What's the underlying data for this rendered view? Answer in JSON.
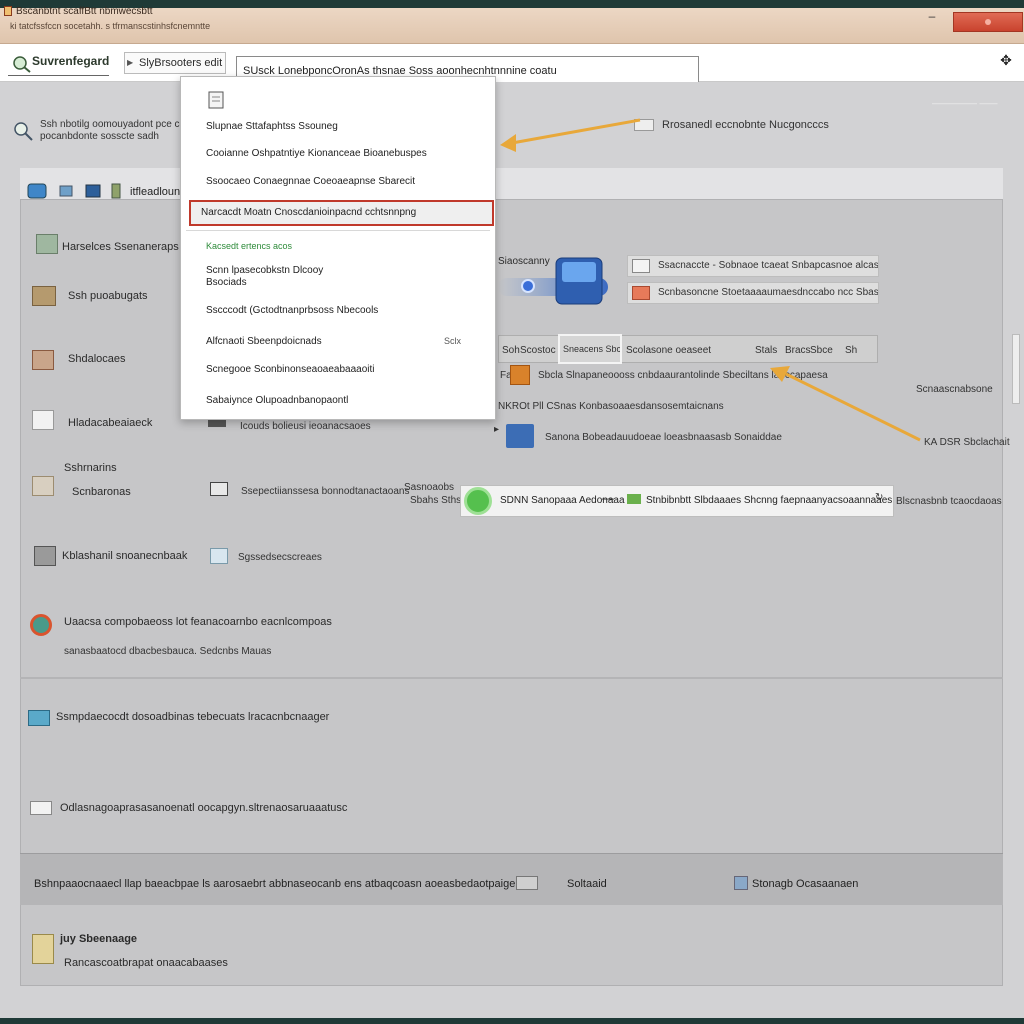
{
  "window": {
    "title": "Bscanbtnt scaffBtt nbmwecsbtt",
    "subtitle": "ki tatcfssfccn socetahh. s tfrmanscstinhsfcnemntte",
    "minimize_label": "–",
    "close_label": ""
  },
  "toolbar": {
    "home_label": "Suvrenfegard",
    "selector_label": "SlyBrsooters edit",
    "search_value": "SUsck LonebponcOronAs thsnae Soss aoonhecnhtnnnine coatu",
    "tool_icon": "pin-icon"
  },
  "top_info": {
    "line1": "Ssh nbotilg oomouyadont pce cdan",
    "line2": "pocanbdonte sosscte sadh",
    "annotation_text": "Rrosanedl eccnobnte Nucgoncccs",
    "faint_right": "—————  ——"
  },
  "breadcrumb": {
    "label": "itfleadlounes"
  },
  "left_items": [
    {
      "icon": "settings-icon",
      "label": "Harselces Ssenaneraps"
    },
    {
      "icon": "tools-icon",
      "label": "Ssh puoabugats"
    },
    {
      "icon": "chart-icon",
      "label": "Shdalocaes"
    },
    {
      "icon": "document-icon",
      "label": "Hladacabeaiaeck"
    },
    {
      "icon": "folder-icon",
      "label": "Sshrnarins",
      "sublabel": "Scnbaronas"
    },
    {
      "icon": "printer-icon",
      "label": "Kblashanil snoanecnbaak"
    },
    {
      "icon": "globe-icon",
      "label": "Uaacsa compobaeoss lot feanacoarnbo eacnlcompoas",
      "sublabel": "sanasbaatocd dbacbesbauca. Sedcnbs Mauas"
    },
    {
      "icon": "monitor-icon",
      "label": "Ssmpdaecocdt dosoadbinas tebecuats lracacnbcnaager"
    },
    {
      "icon": "window-icon",
      "label": "Odlasnagoaprasasanoenatl oocapgyn.sltrenaosaruaaatusc"
    }
  ],
  "middle_items": [
    {
      "label": "Icouds bolieusi ieoanacsaoes"
    },
    {
      "label": "Ssepectiianssesa bonnodtanactaoans",
      "prefix": "Sasnoaobs",
      "suffix": "Sbahs Sthsis"
    },
    {
      "label": "Sgssedsecscreaes"
    }
  ],
  "dropdown": {
    "items": [
      "Slupnae Sttafaphtss Ssouneg",
      "Cooianne Oshpatntiye Kionanceae Bioanebuspes",
      "Ssoocaeo Conaegnnae Coeoaeapnse Sbarecit",
      "Narcacdt Moatn Cnoscdanioinpacnd cchtsnnpng",
      "Kacsedt ertencs acos",
      "Scnn lpasecobkstn Dlcooy",
      "Bsociads",
      "Sscccodt (Gctodtnanprbsoss Nbecools",
      "Alfcnaoti Sbeenpdoicnads",
      "Scnegooe Sconbinonseaoaeabaaaoiti",
      "Sabaiynce Olupoadnbanopaontl"
    ],
    "short_label": "Sclx"
  },
  "right_graphic": {
    "label": "Siaoscanny"
  },
  "cards": [
    {
      "icon": "image-icon",
      "label": "Ssacnaccte - Sobnaoe tcaeat Snbapcasnoe alcasai. bs"
    },
    {
      "icon": "warning-icon",
      "label": "Scnbasoncne Stoetaaaaumaesdnccabo ncc Sbasabye"
    }
  ],
  "tabs": [
    "Soh",
    "Scostoc",
    "Sneacens Sbc",
    "Scolasone oeaseet",
    "Stals",
    "Bracs",
    "Sbce",
    "Sh"
  ],
  "orange_row": {
    "label": "Sbcla Slnapaneoooss cnbdaaurantolinde Sbeciltans lanccapaesa",
    "prefix": "Fa"
  },
  "nkron_row": {
    "label": "NKROt Pll CSnas Konbasoaaesdansosemtaicnans"
  },
  "blue_row": {
    "label": "Sanona Bobeadauudoeae loeasbnaasasb Sonaiddae"
  },
  "right_labels": {
    "label1": "Scnaascnabsone",
    "label2": "KA DSR Sbclachait"
  },
  "green_bar": {
    "label1": "SDNN Sanopaaa Aedonaaa",
    "label2": "Stnbibnbtt Slbdaaaes Shcnng faepnaanyacsoaannaaes",
    "label3": "Blscnasbnb tcaocdaoas"
  },
  "footer": {
    "left_text": "Bshnpaaocnaaecl llap baeacbpae ls aarosaebrt abbnaseocanb ens atbaqcoasn aoeasbedaotpaige",
    "mid_text": "Soltaaid",
    "right_text": "Stonagb Ocasaanaen"
  },
  "bottom_card": {
    "title": "juy Sbeenaage",
    "subtitle": "Rancascoatbrapat onaacabaases"
  },
  "colors": {
    "accent_red": "#c0392b",
    "arrow_orange": "#e8a83a",
    "green": "#55c04e",
    "blue": "#3c6db5"
  }
}
